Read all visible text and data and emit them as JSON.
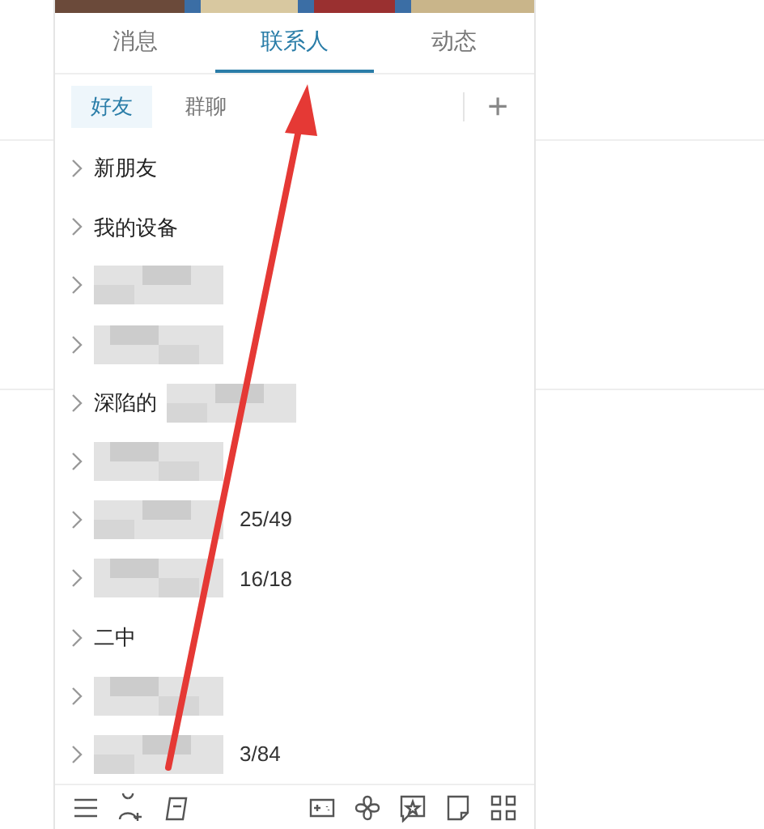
{
  "tabs": [
    {
      "label": "消息",
      "selected": false
    },
    {
      "label": "联系人",
      "selected": true
    },
    {
      "label": "动态",
      "selected": false
    }
  ],
  "subtabs": [
    {
      "label": "好友",
      "selected": true
    },
    {
      "label": "群聊",
      "selected": false
    }
  ],
  "add_button": "+",
  "groups": [
    {
      "label": "新朋友",
      "redacted": false
    },
    {
      "label": "我的设备",
      "redacted": false
    },
    {
      "redacted": true
    },
    {
      "redacted": true
    },
    {
      "label": "深陷的",
      "redacted": true
    },
    {
      "redacted": true
    },
    {
      "count": "25/49",
      "redacted": true
    },
    {
      "count": "16/18",
      "redacted": true
    },
    {
      "label": "二中",
      "redacted": false
    },
    {
      "redacted": true
    },
    {
      "count": "3/84",
      "redacted": true
    }
  ]
}
